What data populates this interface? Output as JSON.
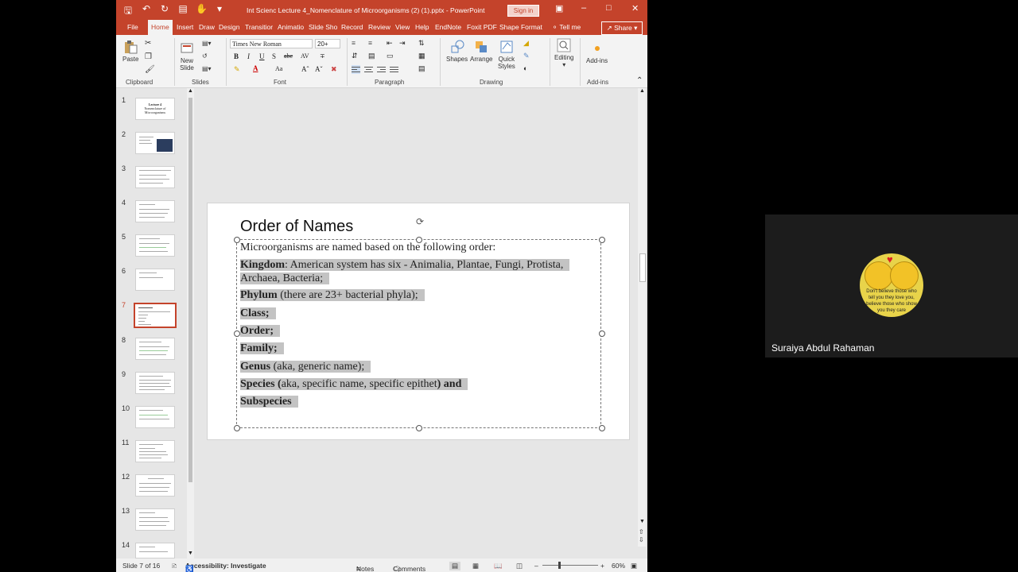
{
  "window": {
    "title": "Int Scienc Lecture 4_Nomenclature of Microorganisms (2) (1).pptx  -  PowerPoint",
    "sign_in": "Sign in"
  },
  "tabs": [
    "File",
    "Home",
    "Insert",
    "Draw",
    "Design",
    "Transitior",
    "Animatio",
    "Slide Sho",
    "Record",
    "Review",
    "View",
    "Help",
    "EndNote",
    "Foxit PDF",
    "Shape Format"
  ],
  "tell_me": "Tell me",
  "share": "Share",
  "ribbon": {
    "paste": "Paste",
    "new_slide_1": "New",
    "new_slide_2": "Slide",
    "font_name": "Times New Roman",
    "font_size": "20+",
    "shapes": "Shapes",
    "arrange": "Arrange",
    "quick_styles_1": "Quick",
    "quick_styles_2": "Styles",
    "editing": "Editing",
    "addins": "Add-ins",
    "groups": {
      "clipboard": "Clipboard",
      "slides": "Slides",
      "font": "Font",
      "paragraph": "Paragraph",
      "drawing": "Drawing",
      "addins": "Add-ins"
    }
  },
  "thumbnails": {
    "numbers": [
      "1",
      "2",
      "3",
      "4",
      "5",
      "6",
      "7",
      "8",
      "9",
      "10",
      "11",
      "12",
      "13",
      "14"
    ],
    "active": "7",
    "slide1_line1": "Lecture 4",
    "slide1_line2": "Nomenclature of",
    "slide1_line3": "Microorganisms"
  },
  "slide": {
    "title": "Order of Names",
    "intro": "Microorganisms are named based on the following order:",
    "kingdom_bold": "Kingdom",
    "kingdom_rest": ": American system has six - Animalia, Plantae, Fungi, Protista,",
    "kingdom_cont": "Archaea, Bacteria;",
    "phylum_bold": "Phylum",
    "phylum_rest": " (there are 23+ bacterial phyla);",
    "class": "Class;",
    "order": "Order;",
    "family": "Family;",
    "genus_bold": "Genus",
    "genus_rest": " (aka, generic name);",
    "species_bold": "Species (",
    "species_rest": "aka, specific name, specific epithet",
    "species_end": ") and",
    "subspecies": "Subspecies"
  },
  "status": {
    "slide_info": "Slide 7 of 16",
    "accessibility": "Accessibility: Investigate",
    "notes": "Notes",
    "comments": "Comments",
    "zoom": "60%"
  },
  "participant": {
    "name": "Suraiya Abdul Rahaman",
    "avatar_text": "Don't believe those who tell you they love you, believe those who show you they care"
  }
}
